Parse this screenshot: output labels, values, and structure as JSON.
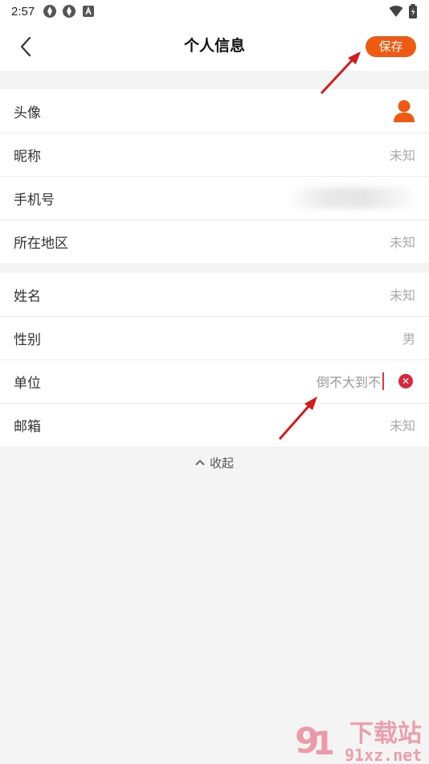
{
  "status_bar": {
    "time": "2:57",
    "icons": [
      "sync-icon",
      "sync-icon",
      "keyboard-a-icon"
    ],
    "right_icons": [
      "wifi-icon",
      "battery-icon"
    ]
  },
  "nav": {
    "title": "个人信息",
    "back_icon": "chevron-left-icon",
    "save_label": "保存",
    "accent_color": "#ee5a12"
  },
  "profile_basic": [
    {
      "label": "头像",
      "type": "avatar",
      "icon": "person-icon"
    },
    {
      "label": "昵称",
      "value": "未知"
    },
    {
      "label": "手机号",
      "value": ""
    },
    {
      "label": "所在地区",
      "value": "未知"
    }
  ],
  "profile_detail": [
    {
      "label": "姓名",
      "value": "未知"
    },
    {
      "label": "性别",
      "value": "男"
    },
    {
      "label": "单位",
      "input_value": "倒不大到不",
      "clear_icon": "clear-icon"
    },
    {
      "label": "邮箱",
      "value": "未知"
    }
  ],
  "collapse_label": "收起",
  "watermark": {
    "brand": "下载站",
    "domain": "91xz.net"
  }
}
